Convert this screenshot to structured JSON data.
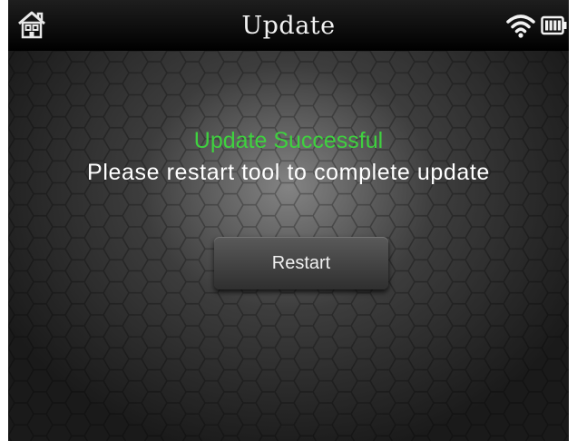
{
  "header": {
    "title": "Update",
    "home_icon": "home-icon",
    "wifi_icon": "wifi-icon",
    "battery_icon": "battery-icon",
    "battery_level": 1.0
  },
  "main": {
    "status": "Update Successful",
    "message": "Please restart tool to complete update",
    "restart_label": "Restart"
  },
  "colors": {
    "success": "#3fd13f",
    "text": "#ffffff",
    "titlebar": "#000000"
  }
}
